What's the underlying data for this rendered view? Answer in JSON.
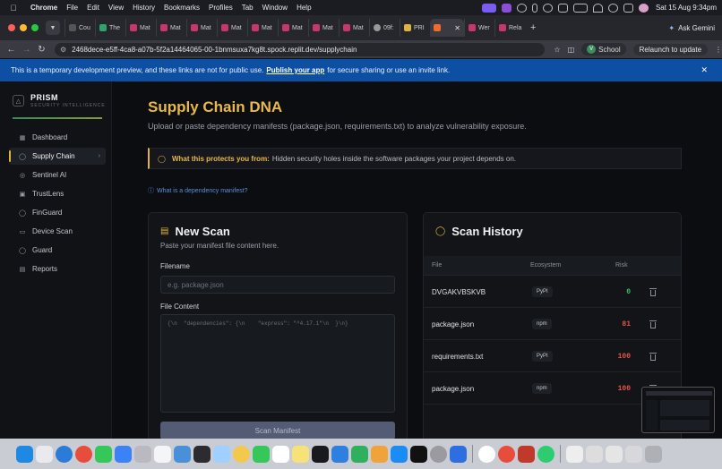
{
  "menubar": {
    "app": "Chrome",
    "items": [
      "File",
      "Edit",
      "View",
      "History",
      "Bookmarks",
      "Profiles",
      "Tab",
      "Window",
      "Help"
    ],
    "datetime": "Sat 15 Aug  9:34pm"
  },
  "tabs": {
    "items": [
      "Cou",
      "The",
      "Mat",
      "Mat",
      "Mat",
      "Mat",
      "Mat",
      "Mat",
      "Mat",
      "Mat",
      "09f:",
      "PRI"
    ],
    "active_label": "",
    "trailing": [
      "Wer",
      "Rela"
    ],
    "ask_gemini": "Ask Gemini"
  },
  "toolbar": {
    "url": "2468dece-e5ff-4ca8-a07b-5f2a14464065-00-1bnmsuxa7kg8t.spock.replit.dev/supplychain",
    "profile_initial": "V",
    "profile_name": "School",
    "relaunch": "Relaunch to update"
  },
  "banner": {
    "text_before": "This is a temporary development preview, and these links are not for public use.",
    "link": "Publish your app",
    "text_after": "for secure sharing or use an invite link."
  },
  "sidebar": {
    "brand": "PRISM",
    "brand_sub": "SECURITY INTELLIGENCE",
    "items": [
      {
        "label": "Dashboard",
        "icon": "grid-icon"
      },
      {
        "label": "Supply Chain",
        "icon": "shield-icon"
      },
      {
        "label": "Sentinel AI",
        "icon": "sentinel-icon"
      },
      {
        "label": "TrustLens",
        "icon": "lens-icon"
      },
      {
        "label": "FinGuard",
        "icon": "finguard-icon"
      },
      {
        "label": "Device Scan",
        "icon": "device-icon"
      },
      {
        "label": "Guard",
        "icon": "guard-icon"
      },
      {
        "label": "Reports",
        "icon": "reports-icon"
      }
    ]
  },
  "page": {
    "title": "Supply Chain DNA",
    "subtitle": "Upload or paste dependency manifests (package.json, requirements.txt) to analyze vulnerability exposure.",
    "protect_label": "What this protects you from:",
    "protect_text": "Hidden security holes inside the software packages your project depends on.",
    "whatis": "What is a dependency manifest?"
  },
  "scan": {
    "title": "New Scan",
    "subtitle": "Paste your manifest file content here.",
    "filename_label": "Filename",
    "filename_placeholder": "e.g. package.json",
    "content_label": "File Content",
    "content_placeholder": "{\\n  \"dependencies\": {\\n    \"express\": \"^4.17.1\"\\n  }\\n}",
    "button": "Scan Manifest"
  },
  "history": {
    "title": "Scan History",
    "columns": [
      "File",
      "Ecosystem",
      "Risk"
    ],
    "rows": [
      {
        "file": "DVGAKVBSKVB",
        "ecosystem": "PyPI",
        "risk": "0"
      },
      {
        "file": "package.json",
        "ecosystem": "npm",
        "risk": "81"
      },
      {
        "file": "requirements.txt",
        "ecosystem": "PyPI",
        "risk": "100"
      },
      {
        "file": "package.json",
        "ecosystem": "npm",
        "risk": "100"
      }
    ]
  },
  "colors": {
    "accent": "#e0b341",
    "risk_low": "#3fbf6a",
    "risk_high": "#e5534b",
    "banner": "#0d4fa3"
  }
}
